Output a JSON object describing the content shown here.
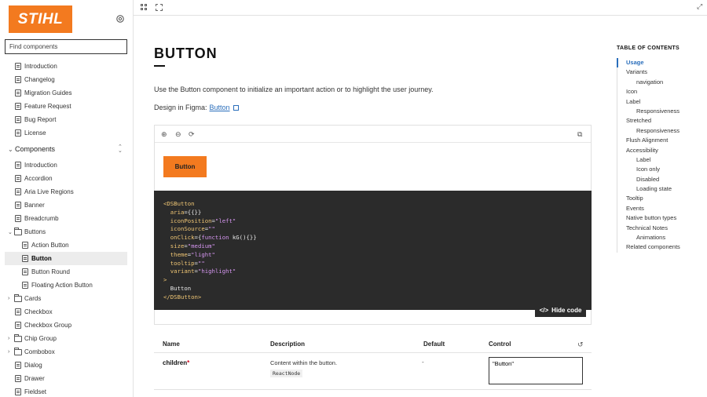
{
  "brand": {
    "logo_text": "STIHL",
    "accent": "#f37a1f"
  },
  "search": {
    "placeholder": "Find components"
  },
  "nav_top": [
    "Introduction",
    "Changelog",
    "Migration Guides",
    "Feature Request",
    "Bug Report",
    "License"
  ],
  "components_section": {
    "label": "Components"
  },
  "nav_components": [
    {
      "label": "Introduction",
      "type": "doc",
      "level": 0
    },
    {
      "label": "Accordion",
      "type": "doc",
      "level": 0
    },
    {
      "label": "Aria Live Regions",
      "type": "doc",
      "level": 0
    },
    {
      "label": "Banner",
      "type": "doc",
      "level": 0
    },
    {
      "label": "Breadcrumb",
      "type": "doc",
      "level": 0
    },
    {
      "label": "Buttons",
      "type": "folder",
      "level": 0,
      "expanded": true
    },
    {
      "label": "Action Button",
      "type": "doc",
      "level": 1
    },
    {
      "label": "Button",
      "type": "doc",
      "level": 1,
      "active": true
    },
    {
      "label": "Button Round",
      "type": "doc",
      "level": 1
    },
    {
      "label": "Floating Action Button",
      "type": "doc",
      "level": 1
    },
    {
      "label": "Cards",
      "type": "folder",
      "level": 0,
      "expanded": false
    },
    {
      "label": "Checkbox",
      "type": "doc",
      "level": 0
    },
    {
      "label": "Checkbox Group",
      "type": "doc",
      "level": 0
    },
    {
      "label": "Chip Group",
      "type": "folder",
      "level": 0,
      "expanded": false
    },
    {
      "label": "Combobox",
      "type": "folder",
      "level": 0,
      "expanded": false
    },
    {
      "label": "Dialog",
      "type": "doc",
      "level": 0
    },
    {
      "label": "Drawer",
      "type": "doc",
      "level": 0
    },
    {
      "label": "Fieldset",
      "type": "doc",
      "level": 0
    }
  ],
  "page": {
    "title": "BUTTON",
    "intro": "Use the Button component to initialize an important action or to highlight the user journey.",
    "figma_prefix": "Design in Figma:",
    "figma_link": "Button"
  },
  "preview": {
    "demo_button": "Button",
    "hide_code": "Hide code",
    "code_lines": [
      [
        {
          "t": "tag",
          "v": "<DSButton"
        }
      ],
      [
        {
          "t": "attr",
          "v": "  aria"
        },
        {
          "t": "txt",
          "v": "={{}}"
        }
      ],
      [
        {
          "t": "attr",
          "v": "  iconPosition"
        },
        {
          "t": "txt",
          "v": "="
        },
        {
          "t": "str",
          "v": "\"left\""
        }
      ],
      [
        {
          "t": "attr",
          "v": "  iconSource"
        },
        {
          "t": "txt",
          "v": "="
        },
        {
          "t": "str",
          "v": "\"\""
        }
      ],
      [
        {
          "t": "attr",
          "v": "  onClick"
        },
        {
          "t": "txt",
          "v": "={"
        },
        {
          "t": "kw",
          "v": "function"
        },
        {
          "t": "txt",
          "v": " kG(){}}"
        }
      ],
      [
        {
          "t": "attr",
          "v": "  size"
        },
        {
          "t": "txt",
          "v": "="
        },
        {
          "t": "str",
          "v": "\"medium\""
        }
      ],
      [
        {
          "t": "attr",
          "v": "  theme"
        },
        {
          "t": "txt",
          "v": "="
        },
        {
          "t": "str",
          "v": "\"light\""
        }
      ],
      [
        {
          "t": "attr",
          "v": "  tooltip"
        },
        {
          "t": "txt",
          "v": "="
        },
        {
          "t": "str",
          "v": "\"\""
        }
      ],
      [
        {
          "t": "attr",
          "v": "  variant"
        },
        {
          "t": "txt",
          "v": "="
        },
        {
          "t": "str",
          "v": "\"highlight\""
        }
      ],
      [
        {
          "t": "tag",
          "v": ">"
        }
      ],
      [
        {
          "t": "txt",
          "v": "  Button"
        }
      ],
      [
        {
          "t": "tag",
          "v": "</DSButton>"
        }
      ]
    ]
  },
  "props_table": {
    "headers": {
      "name": "Name",
      "description": "Description",
      "default": "Default",
      "control": "Control"
    },
    "rows": [
      {
        "name": "children",
        "required_mark": "*",
        "description": "Content within the button.",
        "type": "ReactNode",
        "default": "-",
        "control_value": "\"Button\""
      }
    ]
  },
  "toc": {
    "title": "TABLE OF CONTENTS",
    "items": [
      {
        "label": "Usage",
        "sub": false,
        "active": true
      },
      {
        "label": "Variants",
        "sub": false
      },
      {
        "label": "navigation",
        "sub": true
      },
      {
        "label": "Icon",
        "sub": false
      },
      {
        "label": "Label",
        "sub": false
      },
      {
        "label": "Responsiveness",
        "sub": true
      },
      {
        "label": "Stretched",
        "sub": false
      },
      {
        "label": "Responsiveness",
        "sub": true
      },
      {
        "label": "Flush Alignment",
        "sub": false
      },
      {
        "label": "Accessibility",
        "sub": false
      },
      {
        "label": "Label",
        "sub": true
      },
      {
        "label": "Icon only",
        "sub": true
      },
      {
        "label": "Disabled",
        "sub": true
      },
      {
        "label": "Loading state",
        "sub": true
      },
      {
        "label": "Tooltip",
        "sub": false
      },
      {
        "label": "Events",
        "sub": false
      },
      {
        "label": "Native button types",
        "sub": false
      },
      {
        "label": "Technical Notes",
        "sub": false
      },
      {
        "label": "Animations",
        "sub": true
      },
      {
        "label": "Related components",
        "sub": false
      }
    ]
  }
}
